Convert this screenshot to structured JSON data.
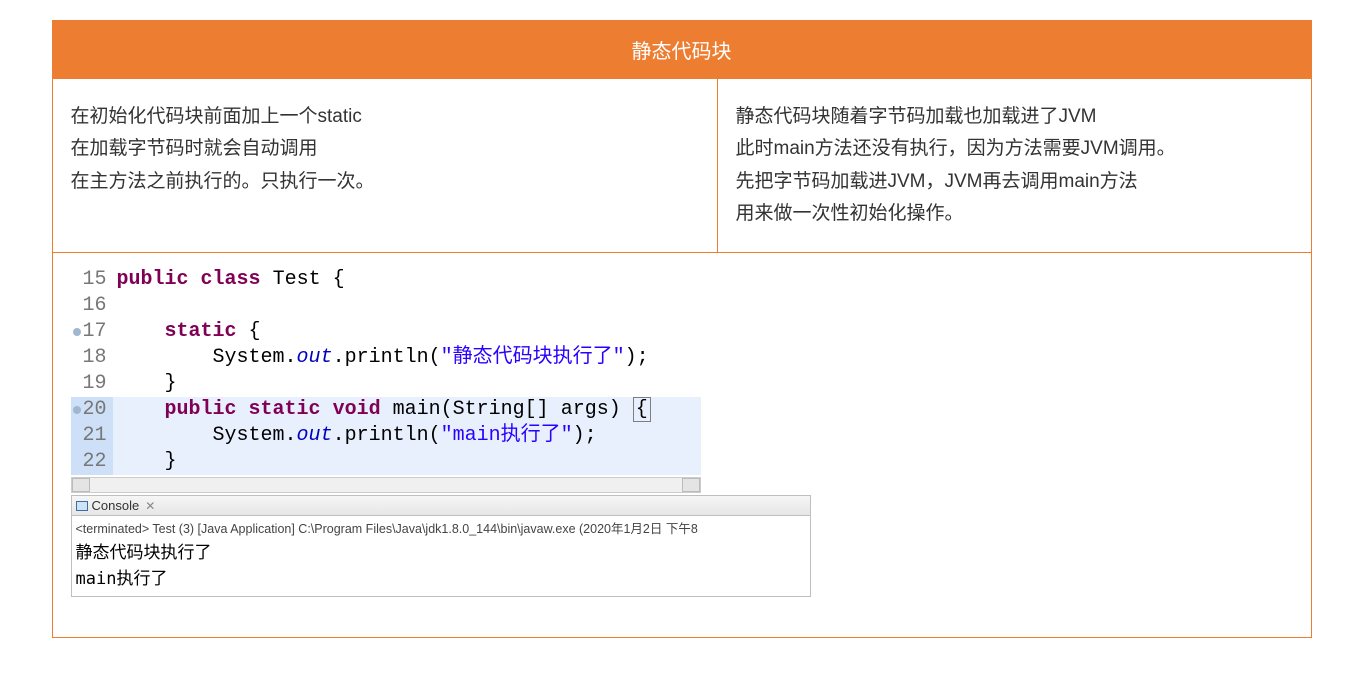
{
  "header": {
    "title": "静态代码块"
  },
  "leftCell": {
    "l1": "在初始化代码块前面加上一个static",
    "l2": "在加载字节码时就会自动调用",
    "l3": "在主方法之前执行的。只执行一次。"
  },
  "rightCell": {
    "l1": "静态代码块随着字节码加载也加载进了JVM",
    "l2": "此时main方法还没有执行，因为方法需要JVM调用。",
    "l3": "先把字节码加载进JVM，JVM再去调用main方法",
    "l4": "用来做一次性初始化操作。"
  },
  "code": {
    "ln15": "15",
    "ln16": "16",
    "ln17": "17",
    "ln18": "18",
    "ln19": "19",
    "ln20": "20",
    "ln21": "21",
    "ln22": "22",
    "kw_public": "public",
    "kw_class": "class",
    "kw_static": "static",
    "kw_void": "void",
    "cls_Test": "Test",
    "cls_System": "System",
    "fld_out": "out",
    "m_println": "println",
    "m_main": "main",
    "ty_String": "String",
    "arg_args": "args",
    "str1": "\"静态代码块执行了\"",
    "str2": "\"main执行了\"",
    "sp1": " ",
    "ob": "{",
    "cb": "}",
    "obb": "{",
    "lp": "(",
    "rp": ")",
    "sc": ";",
    "arr": "[]",
    "dot": "."
  },
  "console": {
    "tab": "Console",
    "close": "✕",
    "status": "<terminated> Test (3) [Java Application] C:\\Program Files\\Java\\jdk1.8.0_144\\bin\\javaw.exe (2020年1月2日 下午8",
    "out1": "静态代码块执行了",
    "out2": "main执行了"
  }
}
